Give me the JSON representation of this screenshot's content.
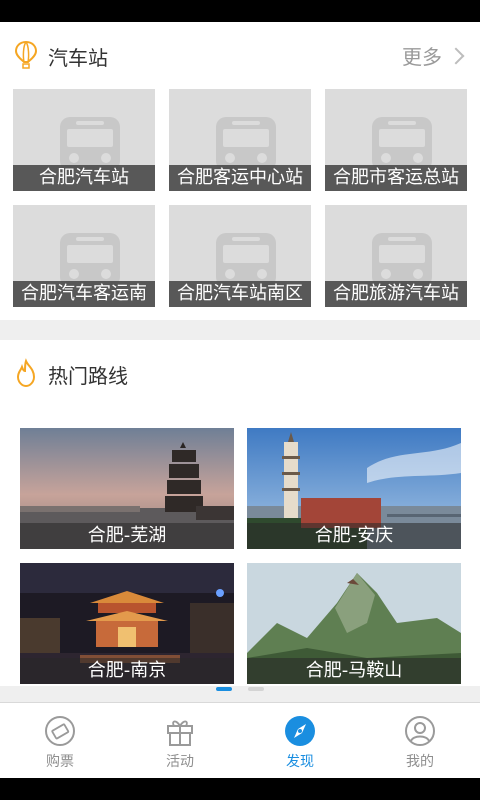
{
  "stations_section": {
    "title": "汽车站",
    "more_label": "更多",
    "stations": [
      {
        "label": "合肥汽车站"
      },
      {
        "label": "合肥客运中心站"
      },
      {
        "label": "合肥市客运总站"
      },
      {
        "label": "合肥汽车客运南"
      },
      {
        "label": "合肥汽车站南区"
      },
      {
        "label": "合肥旅游汽车站"
      }
    ]
  },
  "routes_section": {
    "title": "热门路线",
    "routes": [
      {
        "label": "合肥-芜湖"
      },
      {
        "label": "合肥-安庆"
      },
      {
        "label": "合肥-南京"
      },
      {
        "label": "合肥-马鞍山"
      }
    ],
    "carousel": {
      "active_index": 0,
      "total": 2
    }
  },
  "tabbar": {
    "tabs": [
      {
        "label": "购票",
        "icon": "ticket-icon"
      },
      {
        "label": "活动",
        "icon": "gift-icon"
      },
      {
        "label": "发现",
        "icon": "compass-icon",
        "active": true
      },
      {
        "label": "我的",
        "icon": "user-icon"
      }
    ]
  },
  "colors": {
    "accent": "#1a8ee0",
    "icon_orange": "#f5a623",
    "label_overlay": "#464646"
  }
}
